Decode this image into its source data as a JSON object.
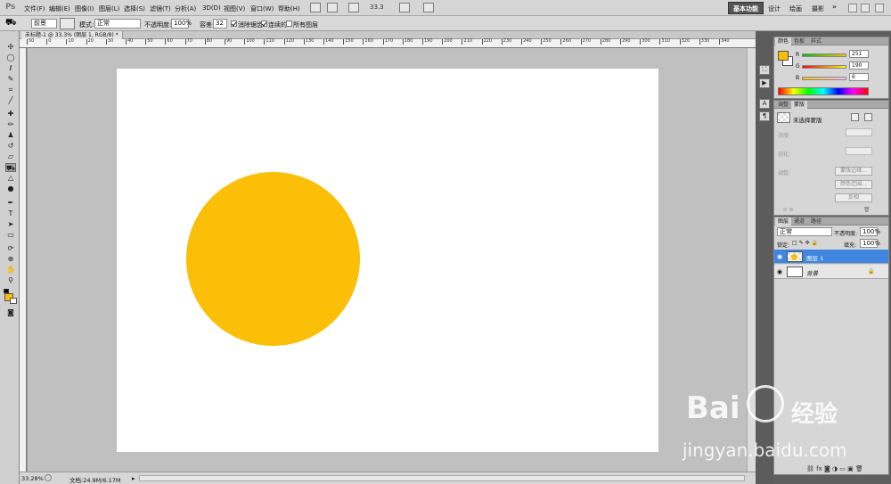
{
  "app": {
    "logo": "Ps"
  },
  "menu": [
    "文件(F)",
    "编辑(E)",
    "图像(I)",
    "图层(L)",
    "选择(S)",
    "滤镜(T)",
    "分析(A)",
    "3D(D)",
    "视图(V)",
    "窗口(W)",
    "帮助(H)"
  ],
  "menubar": {
    "zoom": "33.3",
    "workspaces": [
      "基本功能",
      "设计",
      "绘画",
      "摄影"
    ]
  },
  "options": {
    "fill_source": "前景",
    "mode_label": "模式:",
    "mode_value": "正常",
    "opacity_label": "不透明度:",
    "opacity_value": "100%",
    "tolerance_label": "容差:",
    "tolerance_value": "32",
    "antialias_label": "消除锯齿",
    "contiguous_label": "连续的",
    "all_layers_label": "所有图层"
  },
  "document": {
    "tab_title": "未标题-1 @ 33.3% (图层 1, RGB/8) *",
    "shape_color": "#fbbf07"
  },
  "ruler": [
    "50",
    "0",
    "10",
    "20",
    "30",
    "40",
    "50",
    "60",
    "70",
    "80",
    "90",
    "100",
    "110",
    "120",
    "130",
    "140",
    "150",
    "160",
    "170",
    "180",
    "190",
    "200",
    "210",
    "220",
    "230",
    "240",
    "250",
    "260",
    "270",
    "280",
    "290",
    "300",
    "310",
    "320",
    "330",
    "340"
  ],
  "status": {
    "zoom": "33.28%",
    "doc_info": "文档:24.9M/6.17M"
  },
  "color_panel": {
    "tabs": [
      "颜色",
      "色板",
      "样式"
    ],
    "r": "251",
    "g": "190",
    "b": "6",
    "r_label": "R",
    "g_label": "G",
    "b_label": "B",
    "foreground_color": "#fbbe06"
  },
  "adjust_panel": {
    "tabs": [
      "调整",
      "蒙版"
    ],
    "title": "未选择蒙版",
    "density_label": "浓度:",
    "feather_label": "羽化:",
    "refine_label": "调整:",
    "buttons": [
      "蒙版边缘...",
      "颜色范围...",
      "反相"
    ]
  },
  "layers_panel": {
    "tabs": [
      "图层",
      "通道",
      "路径"
    ],
    "blend": "正常",
    "opacity_label": "不透明度:",
    "opacity": "100%",
    "lock_label": "锁定:",
    "fill_label": "填充:",
    "fill": "100%",
    "layers": [
      {
        "name": "图层 1",
        "selected": true
      },
      {
        "name": "背景",
        "selected": false
      }
    ]
  },
  "watermark": {
    "brand": "Bai",
    "brand2": "经验",
    "url": "jingyan.baidu.com"
  }
}
